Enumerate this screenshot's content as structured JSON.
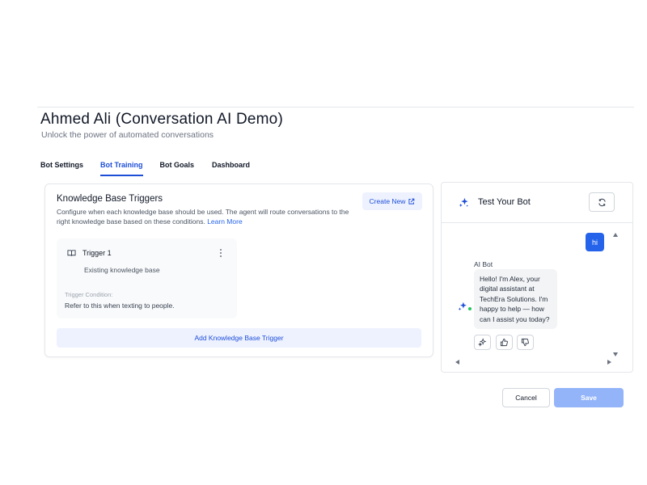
{
  "header": {
    "title": "Ahmed Ali (Conversation AI Demo)",
    "subtitle": "Unlock the power of automated conversations"
  },
  "tabs": [
    {
      "label": "Bot Settings",
      "active": false
    },
    {
      "label": "Bot Training",
      "active": true
    },
    {
      "label": "Bot Goals",
      "active": false
    },
    {
      "label": "Dashboard",
      "active": false
    }
  ],
  "knowledge_base": {
    "title": "Knowledge Base Triggers",
    "description": "Configure when each knowledge base should be used. The agent will route conversations to the right knowledge base based on these conditions.",
    "learn_more": "Learn More",
    "create_new": "Create New",
    "trigger": {
      "name": "Trigger 1",
      "knowledge_base": "Existing knowledge base",
      "condition_label": "Trigger Condition:",
      "condition": "Refer to this when texting to people."
    },
    "add_trigger": "Add Knowledge Base Trigger"
  },
  "test_bot": {
    "title": "Test Your Bot",
    "user_message": "hi",
    "bot_name": "AI Bot",
    "bot_message": "Hello! I'm Alex, your digital assistant at TechEra Solutions. I'm happy to help — how can I assist you today?"
  },
  "footer": {
    "cancel": "Cancel",
    "save": "Save"
  },
  "colors": {
    "accent": "#2563eb",
    "accent_light": "#eef2ff",
    "save_disabled": "#93b4f8",
    "online": "#22c55e"
  },
  "icons": {
    "trigger": "book-icon",
    "create_new": "external-link-icon",
    "test_bot": "sparkle-icon",
    "refresh": "refresh-icon",
    "actions": [
      "sparkle-icon",
      "thumbs-up-icon",
      "thumbs-down-icon"
    ]
  }
}
